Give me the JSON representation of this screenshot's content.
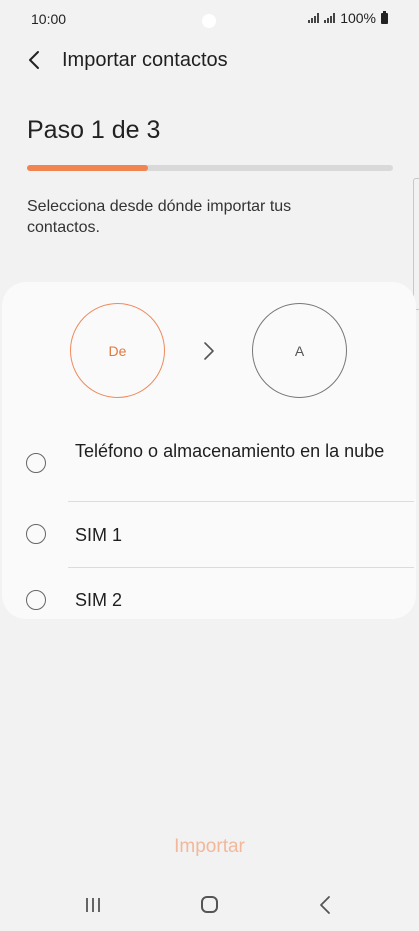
{
  "status_bar": {
    "time": "10:00",
    "battery": "100%"
  },
  "header": {
    "title": "Importar contactos"
  },
  "step": {
    "title": "Paso 1 de 3",
    "progress": 0.33
  },
  "description": "Selecciona desde dónde importar tus contactos.",
  "flow": {
    "from_label": "De",
    "to_label": "A"
  },
  "options": [
    {
      "label": "Teléfono o almacenamiento en la nube",
      "selected": false
    },
    {
      "label": "SIM 1",
      "selected": false
    },
    {
      "label": "SIM 2",
      "selected": false
    }
  ],
  "import_button": "Importar",
  "colors": {
    "accent": "#f08552",
    "accent_disabled": "#f3b89a",
    "background": "#f2f2f2"
  },
  "icons": {
    "back": "chevron-left-icon",
    "arrow": "chevron-right-icon",
    "nav_recent": "recent-apps-icon",
    "nav_home": "home-icon",
    "nav_back": "back-icon"
  }
}
